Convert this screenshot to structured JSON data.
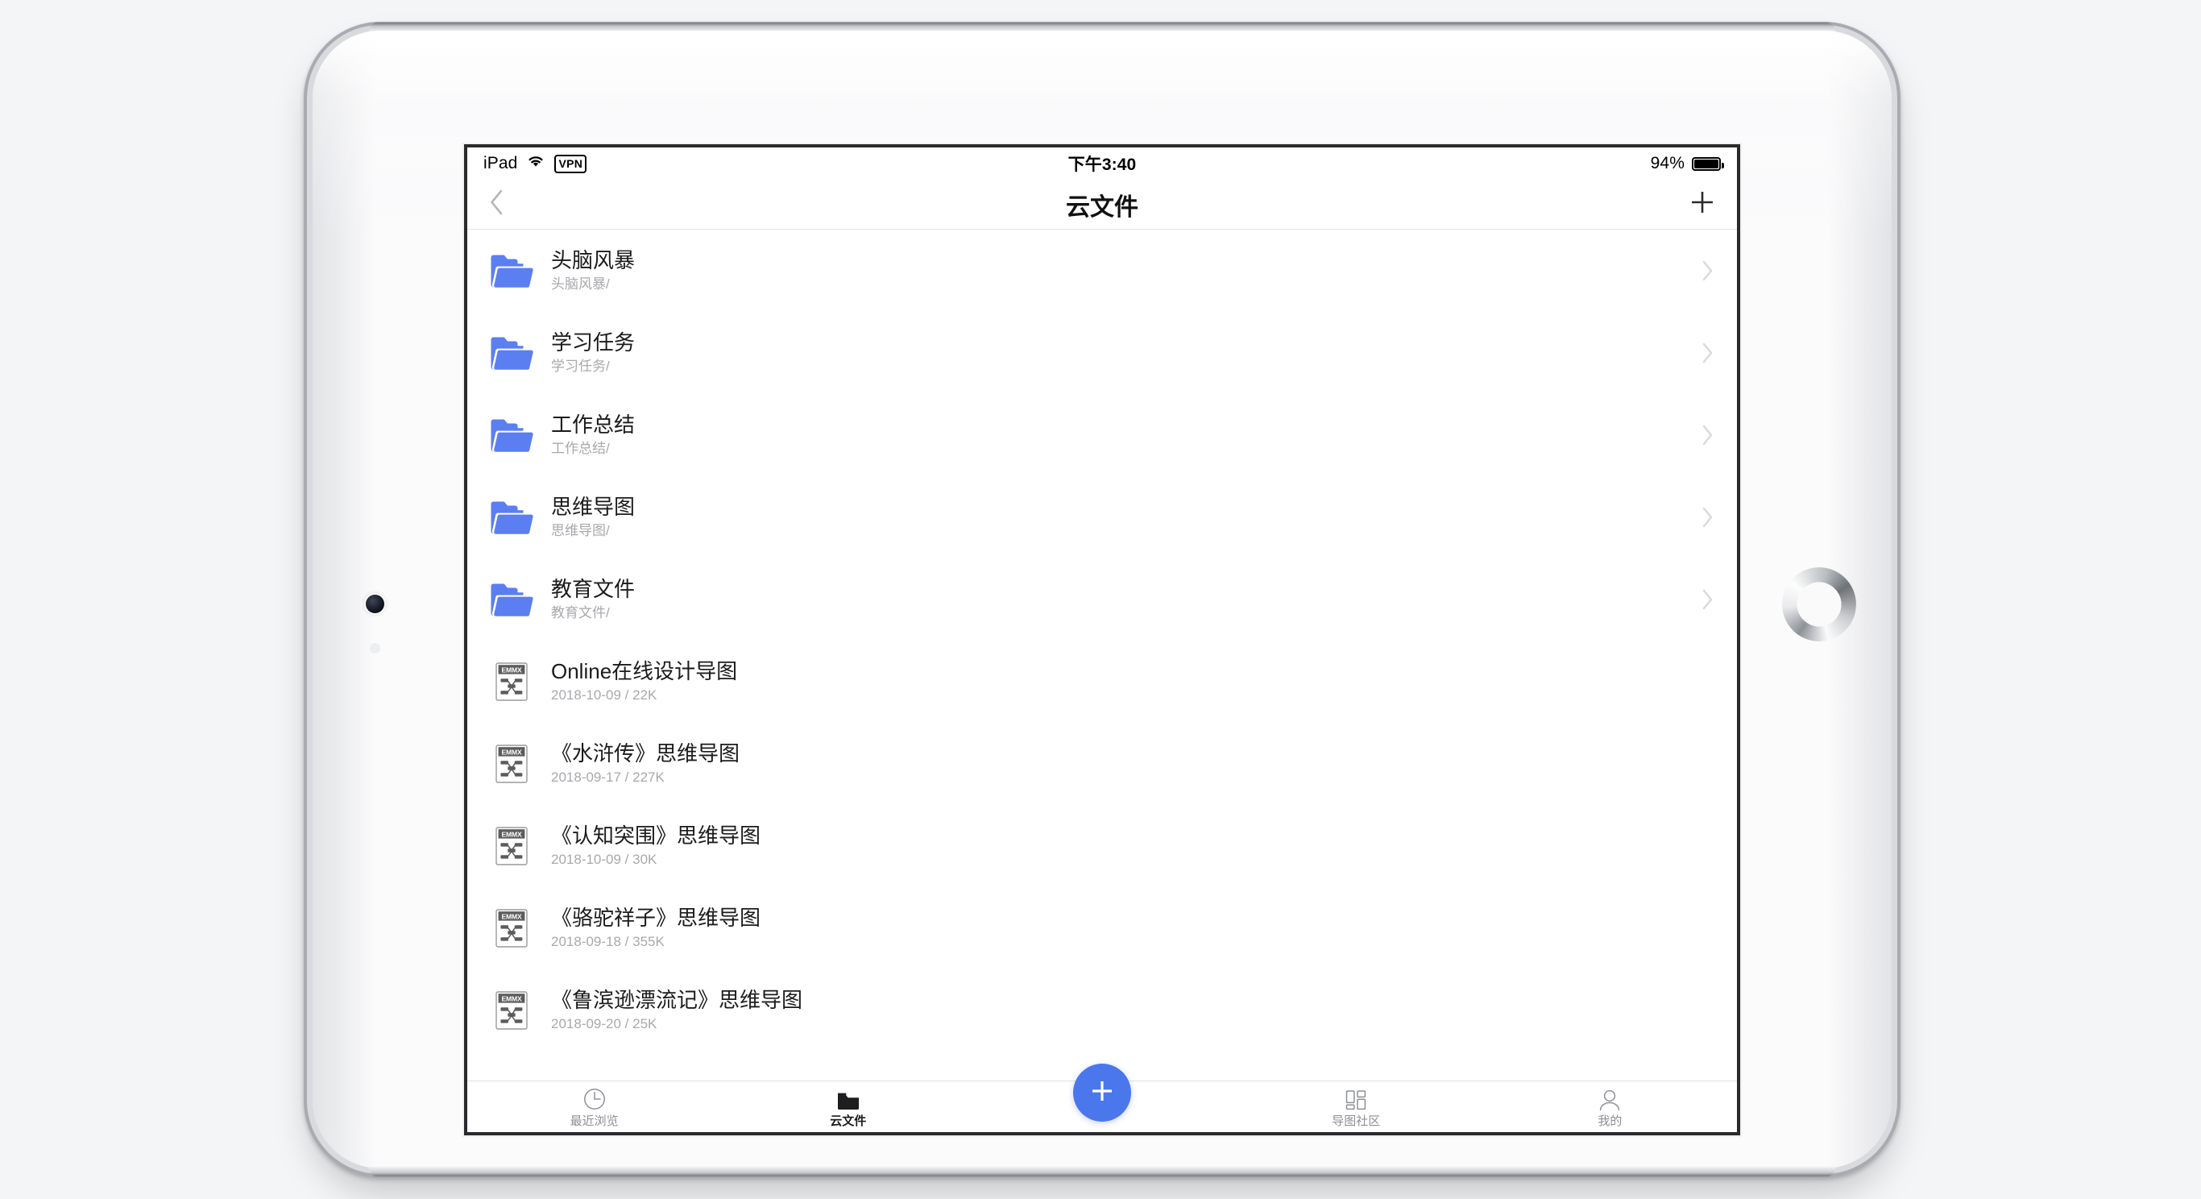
{
  "status_bar": {
    "carrier": "iPad",
    "wifi_icon": "wifi-icon",
    "vpn_label": "VPN",
    "time": "下午3:40",
    "battery_percent": "94%"
  },
  "nav_bar": {
    "back_icon": "chevron-left-icon",
    "title": "云文件",
    "add_icon": "plus-icon"
  },
  "list": {
    "rows": [
      {
        "kind": "folder",
        "title": "头脑风暴",
        "sub": "头脑风暴/"
      },
      {
        "kind": "folder",
        "title": "学习任务",
        "sub": "学习任务/"
      },
      {
        "kind": "folder",
        "title": "工作总结",
        "sub": "工作总结/"
      },
      {
        "kind": "folder",
        "title": "思维导图",
        "sub": "思维导图/"
      },
      {
        "kind": "folder",
        "title": "教育文件",
        "sub": "教育文件/"
      },
      {
        "kind": "file",
        "title": "Online在线设计导图",
        "sub": "2018-10-09 / 22K",
        "badge": "EMMX"
      },
      {
        "kind": "file",
        "title": "《水浒传》思维导图",
        "sub": "2018-09-17 / 227K",
        "badge": "EMMX"
      },
      {
        "kind": "file",
        "title": "《认知突围》思维导图",
        "sub": "2018-10-09 / 30K",
        "badge": "EMMX"
      },
      {
        "kind": "file",
        "title": "《骆驼祥子》思维导图",
        "sub": "2018-09-18 / 355K",
        "badge": "EMMX"
      },
      {
        "kind": "file",
        "title": "《鲁滨逊漂流记》思维导图",
        "sub": "2018-09-20 / 25K",
        "badge": "EMMX"
      }
    ]
  },
  "tab_bar": {
    "tabs": [
      {
        "label": "最近浏览",
        "icon": "clock-icon",
        "active": false
      },
      {
        "label": "云文件",
        "icon": "folder-icon",
        "active": true
      },
      {
        "label": "导图社区",
        "icon": "grid-icon",
        "active": false
      },
      {
        "label": "我的",
        "icon": "person-icon",
        "active": false
      }
    ],
    "fab_icon": "plus-icon"
  },
  "colors": {
    "accent_blue": "#4a77ec",
    "folder_blue": "#5b7ff0",
    "emmx_gray": "#585858",
    "subtext_gray": "#a8a9ad",
    "separator": "#e3e3e5"
  }
}
